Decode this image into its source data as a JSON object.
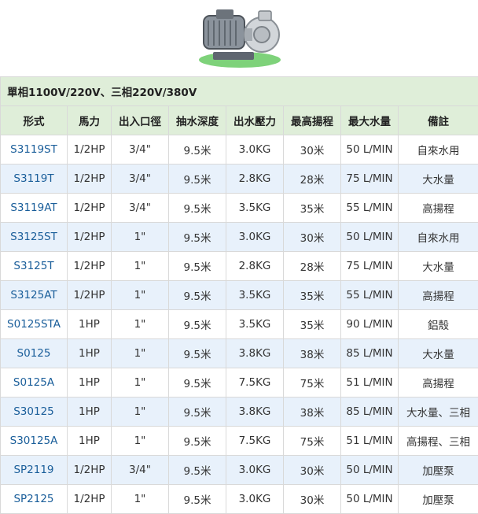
{
  "header": {
    "caption": "單相1100V/220V、三相220V/380V"
  },
  "columns": [
    "形式",
    "馬力",
    "出入口徑",
    "抽水深度",
    "出水壓力",
    "最高揚程",
    "最大水量",
    "備註"
  ],
  "rows": [
    [
      "S3119ST",
      "1/2HP",
      "3/4\"",
      "9.5米",
      "3.0KG",
      "30米",
      "50 L/MIN",
      "自來水用"
    ],
    [
      "S3119T",
      "1/2HP",
      "3/4\"",
      "9.5米",
      "2.8KG",
      "28米",
      "75 L/MIN",
      "大水量"
    ],
    [
      "S3119AT",
      "1/2HP",
      "3/4\"",
      "9.5米",
      "3.5KG",
      "35米",
      "55 L/MIN",
      "高揚程"
    ],
    [
      "S3125ST",
      "1/2HP",
      "1\"",
      "9.5米",
      "3.0KG",
      "30米",
      "50 L/MIN",
      "自來水用"
    ],
    [
      "S3125T",
      "1/2HP",
      "1\"",
      "9.5米",
      "2.8KG",
      "28米",
      "75 L/MIN",
      "大水量"
    ],
    [
      "S3125AT",
      "1/2HP",
      "1\"",
      "9.5米",
      "3.5KG",
      "35米",
      "55 L/MIN",
      "高揚程"
    ],
    [
      "S0125STA",
      "1HP",
      "1\"",
      "9.5米",
      "3.5KG",
      "35米",
      "90 L/MIN",
      "鋁殼"
    ],
    [
      "S0125",
      "1HP",
      "1\"",
      "9.5米",
      "3.8KG",
      "38米",
      "85 L/MIN",
      "大水量"
    ],
    [
      "S0125A",
      "1HP",
      "1\"",
      "9.5米",
      "7.5KG",
      "75米",
      "51 L/MIN",
      "高揚程"
    ],
    [
      "S30125",
      "1HP",
      "1\"",
      "9.5米",
      "3.8KG",
      "38米",
      "85 L/MIN",
      "大水量、三相"
    ],
    [
      "S30125A",
      "1HP",
      "1\"",
      "9.5米",
      "7.5KG",
      "75米",
      "51 L/MIN",
      "高揚程、三相"
    ],
    [
      "SP2119",
      "1/2HP",
      "3/4\"",
      "9.5米",
      "3.0KG",
      "30米",
      "50 L/MIN",
      "加壓泵"
    ],
    [
      "SP2125",
      "1/2HP",
      "1\"",
      "9.5米",
      "3.0KG",
      "30米",
      "50 L/MIN",
      "加壓泵"
    ]
  ],
  "colors": {
    "header_bg": "#dfeed9",
    "stripe_bg": "#e8f1fb",
    "model_text": "#1a5e9a",
    "border": "#d9d9d9"
  }
}
